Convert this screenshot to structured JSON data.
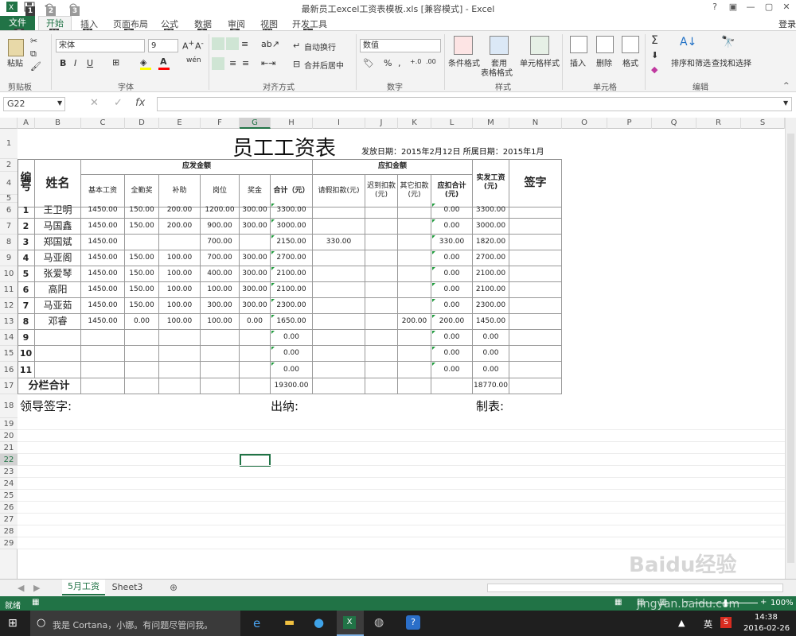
{
  "window": {
    "title": "最新员工excel工资表模板.xls  [兼容模式] - Excel",
    "signin": "登录"
  },
  "ribbon_tabs": [
    {
      "label": "文件",
      "key": "F"
    },
    {
      "label": "开始",
      "key": "H"
    },
    {
      "label": "插入",
      "key": "N"
    },
    {
      "label": "页面布局",
      "key": "P"
    },
    {
      "label": "公式",
      "key": "M"
    },
    {
      "label": "数据",
      "key": "A"
    },
    {
      "label": "审阅",
      "key": "R"
    },
    {
      "label": "视图",
      "key": "W"
    },
    {
      "label": "开发工具",
      "key": "L"
    }
  ],
  "qat_keys": [
    "1",
    "2",
    "3"
  ],
  "ribbon": {
    "paste": "粘贴",
    "font_name": "宋体",
    "font_size": "9",
    "wrap_text": "自动换行",
    "merge_center": "合并后居中",
    "number_format": "数值",
    "cond_format": "条件格式",
    "table_format": "套用",
    "table_format2": "表格格式",
    "cell_styles": "单元格样式",
    "insert": "插入",
    "delete": "删除",
    "format": "格式",
    "sort_filter": "排序和筛选",
    "find_select": "查找和选择",
    "groups": {
      "clipboard": "剪贴板",
      "font": "字体",
      "align": "对齐方式",
      "number": "数字",
      "styles": "样式",
      "cells": "单元格",
      "edit": "编辑"
    },
    "btn_bold": "B",
    "btn_italic": "I",
    "btn_underline": "U",
    "btn_percent": "%",
    "btn_comma": ",",
    "btn_sum": "Σ"
  },
  "formula_bar": {
    "name_box": "G22",
    "fx": "fx",
    "content": ""
  },
  "column_headers": [
    "A",
    "B",
    "C",
    "D",
    "E",
    "F",
    "G",
    "H",
    "I",
    "J",
    "K",
    "L",
    "M",
    "N",
    "O",
    "P",
    "Q",
    "R",
    "S"
  ],
  "row_headers": [
    "1",
    "2",
    "3",
    "4",
    "5",
    "6",
    "7",
    "8",
    "9",
    "10",
    "11",
    "12",
    "13",
    "14",
    "15",
    "16",
    "17",
    "18",
    "19",
    "20",
    "21",
    "22",
    "23",
    "24",
    "25",
    "26",
    "27",
    "28",
    "29"
  ],
  "sheet": {
    "title": "员工工资表",
    "subtitle": "发放日期：2015年2月12日 所属日期：2015年1月",
    "h_no": "编号",
    "h_name": "姓名",
    "h_payable": "应发金额",
    "h_deduct": "应扣金额",
    "h_net": "实发工资(元)",
    "h_sign": "签字",
    "sub_headers": [
      "基本工资",
      "全勤奖",
      "补助",
      "岗位",
      "奖金",
      "合计（元）",
      "请假扣款(元)",
      "迟到扣款(元)",
      "其它扣款(元)",
      "应扣合计(元)"
    ],
    "rows": [
      [
        "1",
        "王卫明",
        "1450.00",
        "150.00",
        "200.00",
        "1200.00",
        "300.00",
        "3300.00",
        "",
        "",
        "",
        "0.00",
        "3300.00"
      ],
      [
        "2",
        "马国鑫",
        "1450.00",
        "150.00",
        "200.00",
        "900.00",
        "300.00",
        "3000.00",
        "",
        "",
        "",
        "0.00",
        "3000.00"
      ],
      [
        "3",
        "郑国斌",
        "1450.00",
        "",
        "",
        "700.00",
        "",
        "2150.00",
        "330.00",
        "",
        "",
        "330.00",
        "1820.00"
      ],
      [
        "4",
        "马亚阁",
        "1450.00",
        "150.00",
        "100.00",
        "700.00",
        "300.00",
        "2700.00",
        "",
        "",
        "",
        "0.00",
        "2700.00"
      ],
      [
        "5",
        "张爱琴",
        "1450.00",
        "150.00",
        "100.00",
        "400.00",
        "300.00",
        "2100.00",
        "",
        "",
        "",
        "0.00",
        "2100.00"
      ],
      [
        "6",
        "高阳",
        "1450.00",
        "150.00",
        "100.00",
        "100.00",
        "300.00",
        "2100.00",
        "",
        "",
        "",
        "0.00",
        "2100.00"
      ],
      [
        "7",
        "马亚茹",
        "1450.00",
        "150.00",
        "100.00",
        "300.00",
        "300.00",
        "2300.00",
        "",
        "",
        "",
        "0.00",
        "2300.00"
      ],
      [
        "8",
        "邓睿",
        "1450.00",
        "0.00",
        "100.00",
        "100.00",
        "0.00",
        "1650.00",
        "",
        "",
        "200.00",
        "200.00",
        "1450.00"
      ],
      [
        "9",
        "",
        "",
        "",
        "",
        "",
        "",
        "0.00",
        "",
        "",
        "",
        "0.00",
        "0.00"
      ],
      [
        "10",
        "",
        "",
        "",
        "",
        "",
        "",
        "0.00",
        "",
        "",
        "",
        "0.00",
        "0.00"
      ],
      [
        "11",
        "",
        "",
        "",
        "",
        "",
        "",
        "0.00",
        "",
        "",
        "",
        "0.00",
        "0.00"
      ]
    ],
    "total_label": "分栏合计",
    "total_sum": "19300.00",
    "total_net": "18770.00",
    "sig_leader": "领导签字:",
    "sig_cashier": "出纳:",
    "sig_maker": "制表:"
  },
  "sheet_tabs": [
    "5月工资",
    "Sheet3"
  ],
  "status": {
    "ready": "就绪",
    "zoom": "100%"
  },
  "taskbar": {
    "cortana": "我是 Cortana，小娜。有问题尽管问我。",
    "time": "14:38",
    "date": "2016-02-26",
    "ime": "英",
    "watermark": "Baidu经验",
    "watermark_url": "jingyan.baidu.com"
  }
}
